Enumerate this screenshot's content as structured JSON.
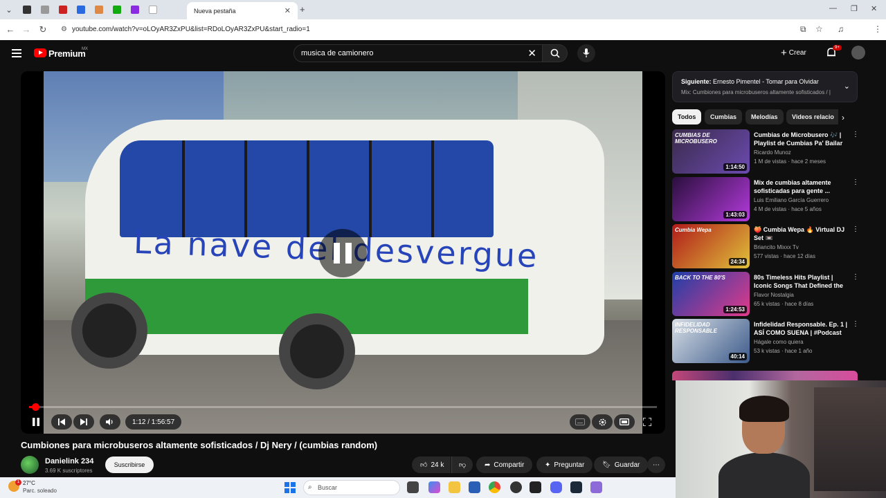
{
  "browser": {
    "tab_title": "Nueva pestaña",
    "url": "youtube.com/watch?v=oLOyAR3ZxPU&list=RDoLOyAR3ZxPU&start_radio=1"
  },
  "header": {
    "brand": "Premium",
    "region": "MX",
    "search_value": "musica de camionero",
    "create_label": "Crear",
    "notif_badge": "9+"
  },
  "player": {
    "overlay_text": "La nave del desvergue",
    "time": "1:12 / 1:56:57",
    "progress": 0.0102
  },
  "video": {
    "title": "Cumbiones para microbuseros altamente sofisticados / Dj Nery / (cumbias random)",
    "channel": "Danielink 234",
    "subscribers": "3.69 K suscriptores",
    "subscribe_label": "Suscribirse",
    "likes": "24 k",
    "share_label": "Compartir",
    "ask_label": "Preguntar",
    "save_label": "Guardar"
  },
  "sidebar": {
    "next_label": "Siguiente:",
    "next_title": "Ernesto Pimentel - Tomar para Olvidar",
    "next_sub": "Mix: Cumbiones para microbuseros altamente sofisticados / |",
    "chips": [
      "Todos",
      "Cumbias",
      "Melodías",
      "Videos relacio"
    ],
    "recs": [
      {
        "title": "Cumbias de Microbusero 🎶 | Playlist de Cumbias Pa' Bailar ...",
        "channel": "Ricardo Munoz",
        "meta": "1 M de vistas · hace 2 meses",
        "duration": "1:14:50",
        "thumb_text": "CUMBIAS DE MICROBUSERO",
        "color1": "#3a2a4a",
        "color2": "#6b4bb0"
      },
      {
        "title": "Mix de cumbias altamente sofisticadas para gente ...",
        "channel": "Luis Emiliano García Guerrero",
        "meta": "4 M de vistas · hace 5 años",
        "duration": "1:43:03",
        "thumb_text": "",
        "color1": "#2a0f3d",
        "color2": "#b33adb"
      },
      {
        "title": "🍑 Cumbia Wepa 🔥 Virtual DJ Set 📼",
        "channel": "Briancito Mixxx Tv",
        "meta": "577 vistas · hace 12 días",
        "duration": "24:34",
        "thumb_text": "Cumbia Wepa",
        "color1": "#b01a1a",
        "color2": "#e0c23a"
      },
      {
        "title": "80s Timeless Hits Playlist | Iconic Songs That Defined the ...",
        "channel": "Flavor Nostalgia",
        "meta": "65 k vistas · hace 8 días",
        "duration": "1:24:53",
        "thumb_text": "BACK TO THE 80'S",
        "color1": "#1e3fa8",
        "color2": "#e23a8a"
      },
      {
        "title": "Infidelidad Responsable. Ep. 1 | ASÍ COMO SUENA | #Podcast",
        "channel": "Hágale como quiera",
        "meta": "53 k vistas · hace 1 año",
        "duration": "40:14",
        "thumb_text": "INFIDELIDAD RESPONSABLE",
        "color1": "#d8dfe6",
        "color2": "#3c5a8a"
      }
    ]
  },
  "taskbar": {
    "temp": "27°C",
    "condition": "Parc. soleado",
    "search_placeholder": "Buscar",
    "weather_badge": "1"
  },
  "colors": {
    "accent": "#ff0000",
    "bg": "#0f0f0f",
    "chip": "#272727"
  }
}
